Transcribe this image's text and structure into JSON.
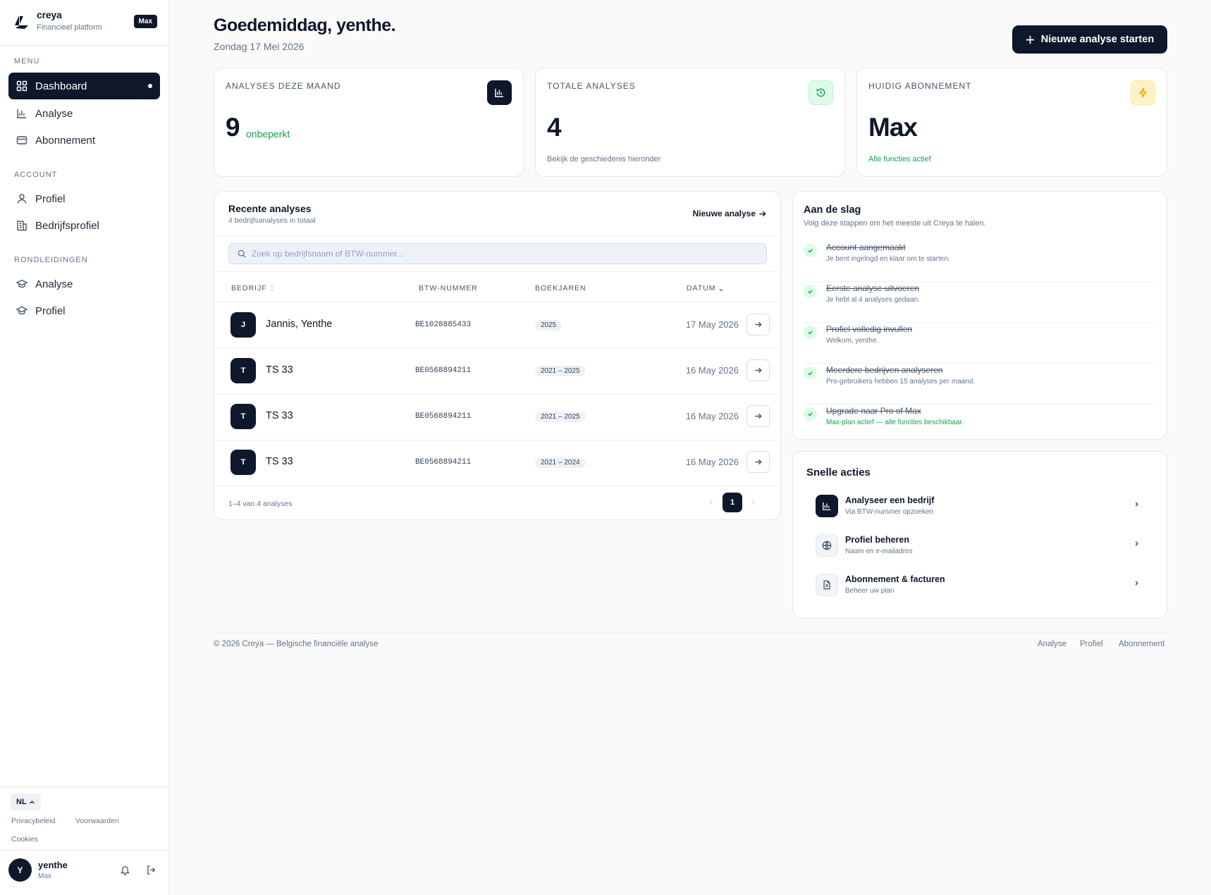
{
  "brand": {
    "name": "creya",
    "tagline": "Financieel platform",
    "plan_badge": "Max"
  },
  "sidebar": {
    "menu_label": "MENU",
    "menu": [
      {
        "label": "Dashboard",
        "icon": "grid-icon",
        "active": true
      },
      {
        "label": "Analyse",
        "icon": "bar-chart-icon"
      },
      {
        "label": "Abonnement",
        "icon": "card-icon"
      }
    ],
    "account_label": "ACCOUNT",
    "account": [
      {
        "label": "Profiel",
        "icon": "user-icon"
      },
      {
        "label": "Bedrijfsprofiel",
        "icon": "building-icon"
      }
    ],
    "tours_label": "RONDLEIDINGEN",
    "tours": [
      {
        "label": "Analyse",
        "icon": "graduation-cap-icon"
      },
      {
        "label": "Profiel",
        "icon": "graduation-cap-icon"
      }
    ],
    "language": "NL",
    "links": {
      "privacy": "Privacybeleid",
      "terms": "Voorwaarden",
      "cookies": "Cookies"
    },
    "user": {
      "initial": "Y",
      "name": "yenthe",
      "plan": "Max"
    }
  },
  "header": {
    "greeting": "Goedemiddag, yenthe.",
    "date": "Zondag 17 Mei 2026",
    "cta_label": "Nieuwe analyse starten"
  },
  "stats": [
    {
      "label": "ANALYSES DEZE MAAND",
      "value": "9",
      "suffix": "onbeperkt",
      "icon": "bar-chart-icon"
    },
    {
      "label": "TOTALE ANALYSES",
      "value": "4",
      "note": "Bekijk de geschiedenis hieronder",
      "icon": "history-icon"
    },
    {
      "label": "HUIDIG ABONNEMENT",
      "value": "Max",
      "note": "Alle functies actief",
      "icon": "lightning-icon"
    }
  ],
  "recent": {
    "title": "Recente analyses",
    "subtitle": "4 bedrijfsanalyses in totaal",
    "link_label": "Nieuwe analyse",
    "search_placeholder": "Zoek op bedrijfsnaam of BTW-nummer...",
    "columns": {
      "company": "BEDRIJF",
      "vat": "BTW-NUMMER",
      "years": "BOEKJAREN",
      "date": "DATUM"
    },
    "rows": [
      {
        "initial": "J",
        "company": "Jannis, Yenthe",
        "vat": "BE1028885433",
        "years": "2025",
        "date": "17 May 2026"
      },
      {
        "initial": "T",
        "company": "TS 33",
        "vat": "BE0568894211",
        "years": "2021 – 2025",
        "date": "16 May 2026"
      },
      {
        "initial": "T",
        "company": "TS 33",
        "vat": "BE0568894211",
        "years": "2021 – 2025",
        "date": "16 May 2026"
      },
      {
        "initial": "T",
        "company": "TS 33",
        "vat": "BE0568894211",
        "years": "2021 – 2024",
        "date": "16 May 2026"
      }
    ],
    "pagination_info": "1–4 van 4 analyses",
    "current_page": "1"
  },
  "getting_started": {
    "title": "Aan de slag",
    "subtitle": "Volg deze stappen om het meeste uit Creya te halen.",
    "steps": [
      {
        "title": "Account aangemaakt",
        "desc": "Je bent ingelogd en klaar om te starten."
      },
      {
        "title": "Eerste analyse uitvoeren",
        "desc": "Je hebt al 4 analyses gedaan."
      },
      {
        "title": "Profiel volledig invullen",
        "desc": "Welkom, yenthe."
      },
      {
        "title": "Meerdere bedrijven analyseren",
        "desc": "Pro-gebruikers hebben 15 analyses per maand."
      },
      {
        "title": "Upgrade naar Pro of Max",
        "desc": "Max-plan actief — alle functies beschikbaar."
      }
    ]
  },
  "quick_actions": {
    "title": "Snelle acties",
    "items": [
      {
        "title": "Analyseer een bedrijf",
        "desc": "Via BTW-nummer opzoeken",
        "icon": "bar-chart-icon"
      },
      {
        "title": "Profiel beheren",
        "desc": "Naam en e-mailadres",
        "icon": "globe-icon"
      },
      {
        "title": "Abonnement & facturen",
        "desc": "Beheer uw plan",
        "icon": "document-icon"
      }
    ]
  },
  "footer": {
    "copyright": "© 2026 Creya — Belgische financiële analyse",
    "links": [
      "Analyse",
      "Profiel",
      "Abonnement"
    ]
  },
  "colors": {
    "primary": "#0f172a",
    "accent_green": "#16a34a",
    "accent_amber": "#f59e0b",
    "background": "#fafafa"
  }
}
